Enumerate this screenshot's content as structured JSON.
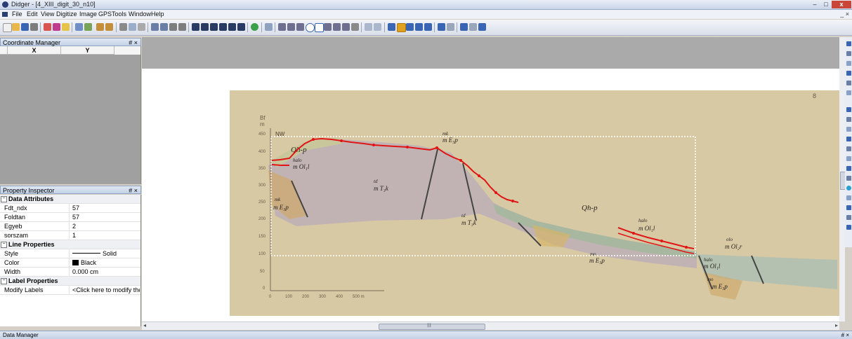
{
  "window": {
    "title": "Didger - [4_XIII_digit_30_n10]",
    "min": "–",
    "max": "□",
    "close": "x"
  },
  "menu": {
    "items": [
      "File",
      "Edit",
      "View",
      "Digitize",
      "Image",
      "GPS",
      "Tools",
      "Window",
      "Help"
    ],
    "mdi_controls": "_ ×"
  },
  "coordinate_manager": {
    "title": "Coordinate Manager",
    "pin": "# ×",
    "col_x": "X",
    "col_y": "Y"
  },
  "property_inspector": {
    "title": "Property Inspector",
    "pin": "# ×",
    "data_attributes": {
      "header": "Data Attributes",
      "rows": [
        {
          "key": "Fdt_ndx",
          "value": "57"
        },
        {
          "key": "Foldtan",
          "value": "57"
        },
        {
          "key": "Egyeb",
          "value": "2"
        },
        {
          "key": "sorszam",
          "value": "1"
        }
      ]
    },
    "line_properties": {
      "header": "Line Properties",
      "style_key": "Style",
      "style_value": "Solid",
      "color_key": "Color",
      "color_value": "Black",
      "width_key": "Width",
      "width_value": "0.000 cm"
    },
    "label_properties": {
      "header": "Label Properties",
      "modify_key": "Modify Labels",
      "modify_value": "<Click here to modify the"
    },
    "toggle": "−"
  },
  "map": {
    "page_number": "8",
    "axis_unit": "m",
    "axis_label": "Bf",
    "y_ticks": [
      "450",
      "400",
      "350",
      "300",
      "250",
      "200",
      "150",
      "100",
      "50",
      "0"
    ],
    "scale_ticks": [
      "0",
      "100",
      "200",
      "300",
      "400",
      "500 m"
    ],
    "labels": {
      "qhp1": "Qh-p",
      "halo1": "halo",
      "ol1": "m Ol₁l",
      "mk1": "mk",
      "e3p1": "m E₃p",
      "mk2": "mk",
      "e3p2": "m E₃p",
      "td1": "td",
      "t3k1": "m T₃k",
      "td2": "td",
      "t3k2": "m T₃k",
      "qhp2": "Qh-p",
      "halo2": "halo",
      "ol2": "m Ol₁l",
      "mo": "mo",
      "e3p3": "m E₃p",
      "olo": "olo",
      "ol2r": "m Ol₂r",
      "halo3": "halo",
      "ol3": "m Ol₁l",
      "mo2": "mo",
      "e3p4": "m E₃p",
      "corner": "NW"
    }
  },
  "hscroll": {
    "grip": "∥∥",
    "left": "◂",
    "right": "▸"
  },
  "data_manager": {
    "title": "Data Manager",
    "pin": "# ×"
  },
  "colors": {
    "accent": "#3a64b4",
    "digitize_red": "#e01515"
  }
}
